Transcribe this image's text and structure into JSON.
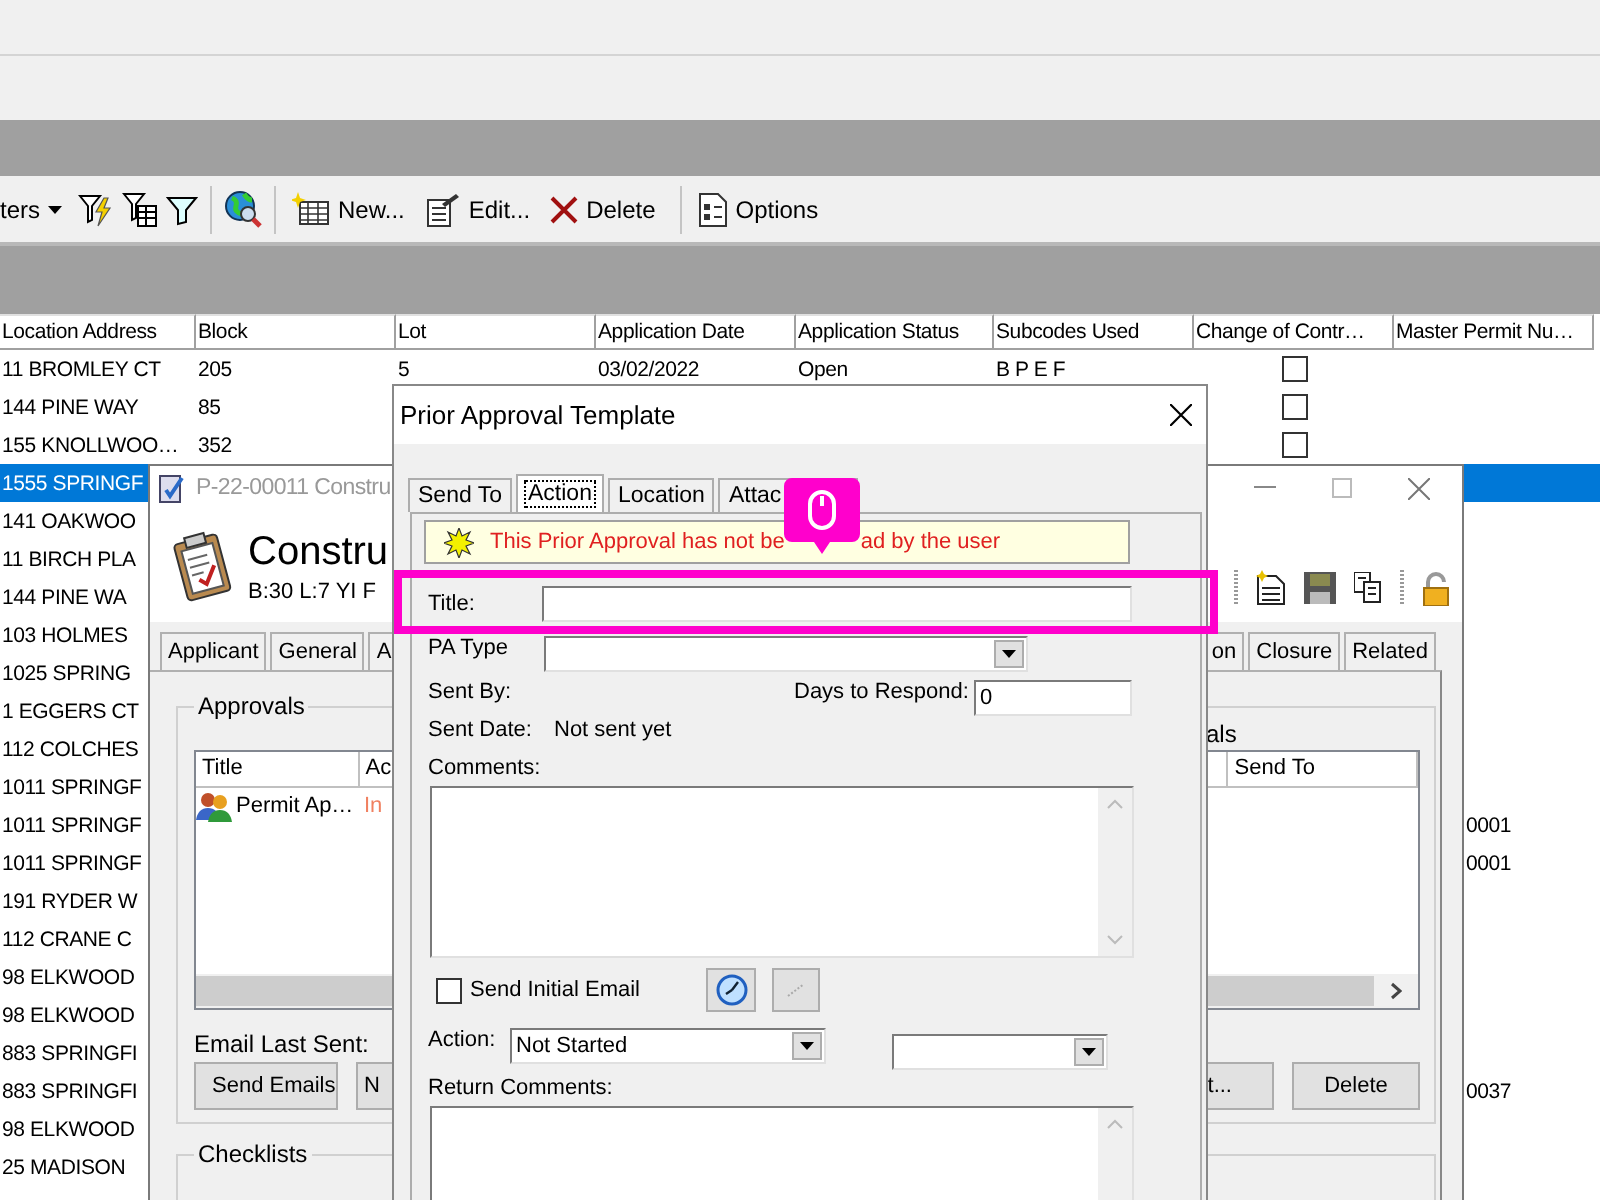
{
  "main_window": {
    "toolbar": {
      "filter_menu": "ters",
      "actions": [
        {
          "kind": "new",
          "label": "New..."
        },
        {
          "kind": "edit",
          "label": "Edit..."
        },
        {
          "kind": "delete",
          "label": "Delete"
        },
        {
          "kind": "options",
          "label": "Options"
        }
      ]
    },
    "table": {
      "columns": [
        "Location Address",
        "Block",
        "Lot",
        "Application Date",
        "Application Status",
        "Subcodes Used",
        "Change of Contr…",
        "Master Permit Nu…"
      ],
      "rows": [
        {
          "address": "11 BROMLEY CT",
          "block": "205",
          "lot": "5",
          "application_date": "03/02/2022",
          "application_status": "Open",
          "subcodes_used": "B P E F",
          "checked": false,
          "selected": false
        },
        {
          "address": "144 PINE WAY",
          "block": "85",
          "checked": false,
          "selected": false
        },
        {
          "address": "155 KNOLLWOO…",
          "block": "352",
          "checked": false,
          "selected": false
        },
        {
          "address": "1555 SPRINGF",
          "selected": true
        },
        {
          "address": "141 OAKWOO",
          "selected": false
        },
        {
          "address": "11 BIRCH PLA",
          "selected": false
        },
        {
          "address": "144 PINE WA",
          "selected": false
        },
        {
          "address": "103 HOLMES",
          "selected": false
        },
        {
          "address": "1025 SPRING",
          "selected": false
        },
        {
          "address": "1 EGGERS CT",
          "selected": false
        },
        {
          "address": "112 COLCHES",
          "selected": false
        },
        {
          "address": "1011 SPRINGF",
          "selected": false
        },
        {
          "address": "1011 SPRINGF",
          "master_permit_number": "0001",
          "selected": false
        },
        {
          "address": "1011 SPRINGF",
          "master_permit_number": "0001",
          "selected": false
        },
        {
          "address": "191 RYDER W",
          "selected": false
        },
        {
          "address": "112 CRANE C",
          "selected": false
        },
        {
          "address": "98 ELKWOOD",
          "selected": false
        },
        {
          "address": "98 ELKWOOD",
          "selected": false
        },
        {
          "address": "883 SPRINGFI",
          "selected": false
        },
        {
          "address": "883 SPRINGFI",
          "master_permit_number": "0037",
          "selected": false
        },
        {
          "address": "98 ELKWOOD",
          "selected": false
        },
        {
          "address": "25 MADISON",
          "selected": false
        }
      ]
    }
  },
  "record_window": {
    "title": "P-22-00011 Constru",
    "heading": "Constru",
    "subheading": "B:30 L:7 YI F",
    "tabs": [
      {
        "label": "Applicant",
        "selected": false
      },
      {
        "label": "General",
        "selected": false
      },
      {
        "label": "A",
        "selected": false
      },
      {
        "label": "on",
        "selected": false
      },
      {
        "label": "Closure",
        "selected": false
      },
      {
        "label": "Related",
        "selected": false
      }
    ],
    "approvals": {
      "label": "Approvals",
      "sub_label": "als",
      "columns": [
        "Title",
        "Ac",
        "Send To"
      ],
      "rows": [
        {
          "title": "Permit Ap…",
          "status": "In"
        }
      ],
      "email_last_sent_label": "Email Last Sent:",
      "buttons": [
        {
          "label": "Send Emails"
        },
        {
          "label": "N"
        },
        {
          "label": "t..."
        },
        {
          "label": "Delete"
        }
      ]
    },
    "checklists": {
      "label": "Checklists"
    }
  },
  "dialog": {
    "title": "Prior Approval Template",
    "tabs": [
      {
        "label": "Send To",
        "selected": false
      },
      {
        "label": "Action",
        "selected": true
      },
      {
        "label": "Location",
        "selected": false
      },
      {
        "label": "Attac",
        "selected": false
      }
    ],
    "warning": {
      "text_before": "This Prior Approval has not be",
      "text_after": "ad by the user"
    },
    "title_label": "Title:",
    "pa_type_label": "PA Type",
    "sent_by_label": "Sent By:",
    "days_to_respond": {
      "label": "Days to Respond:",
      "value": "0"
    },
    "sent_date": {
      "label": "Sent Date:",
      "value": "Not sent yet"
    },
    "comments_label": "Comments:",
    "send_initial_email": {
      "label": "Send Initial Email",
      "checked": false
    },
    "action": {
      "label": "Action:",
      "value": "Not Started"
    },
    "return_comments_label": "Return Comments:"
  }
}
